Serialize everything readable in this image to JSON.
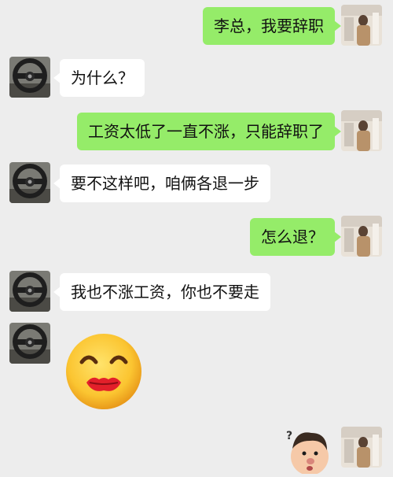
{
  "chat": {
    "messages": [
      {
        "sender": "me",
        "text": "李总，我要辞职"
      },
      {
        "sender": "boss",
        "text": "为什么？"
      },
      {
        "sender": "me",
        "text": "工资太低了一直不涨，只能辞职了"
      },
      {
        "sender": "boss",
        "text": "要不这样吧，咱俩各退一步"
      },
      {
        "sender": "me",
        "text": "怎么退？"
      },
      {
        "sender": "boss",
        "text": "我也不涨工资，你也不要走"
      },
      {
        "sender": "boss",
        "sticker": "kissing-smiley-emoji"
      },
      {
        "sender": "me",
        "sticker": "confused-face-sticker"
      }
    ]
  },
  "colors": {
    "background": "#ededed",
    "my_bubble": "#95ec69",
    "other_bubble": "#ffffff"
  },
  "icons": {
    "my_avatar": "person-photo-avatar",
    "boss_avatar": "car-steering-wheel-avatar"
  }
}
